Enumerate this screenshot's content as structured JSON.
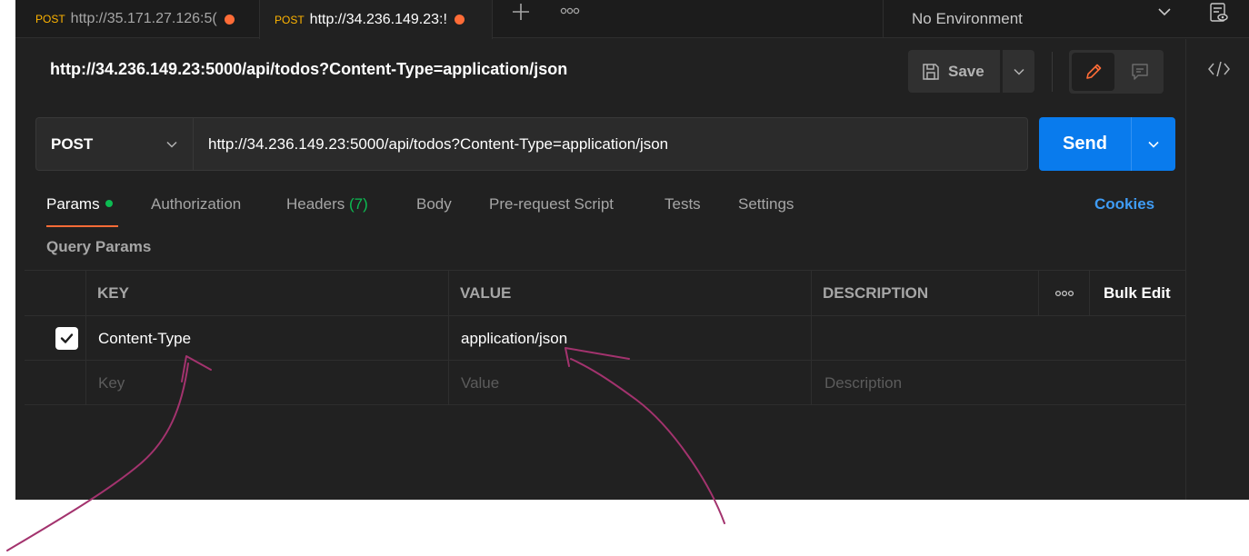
{
  "tabs": [
    {
      "method": "POST",
      "url": "http://35.171.27.126:5("
    },
    {
      "method": "POST",
      "url": "http://34.236.149.23:!"
    }
  ],
  "environment": {
    "selected": "No Environment"
  },
  "request": {
    "title": "http://34.236.149.23:5000/api/todos?Content-Type=application/json",
    "method": "POST",
    "url": "http://34.236.149.23:5000/api/todos?Content-Type=application/json"
  },
  "toolbar": {
    "save_label": "Save",
    "send_label": "Send"
  },
  "request_tabs": {
    "params": "Params",
    "authorization": "Authorization",
    "headers": "Headers",
    "headers_count": "(7)",
    "body": "Body",
    "prerequest": "Pre-request Script",
    "tests": "Tests",
    "settings": "Settings",
    "cookies": "Cookies"
  },
  "query_params": {
    "section_label": "Query Params",
    "columns": {
      "key": "KEY",
      "value": "VALUE",
      "description": "DESCRIPTION",
      "bulk_edit": "Bulk Edit"
    },
    "rows": [
      {
        "checked": true,
        "key": "Content-Type",
        "value": "application/json",
        "description": ""
      }
    ],
    "placeholders": {
      "key": "Key",
      "value": "Value",
      "description": "Description"
    }
  },
  "colors": {
    "accent_orange": "#ff6c37",
    "send_blue": "#097bed",
    "active_green": "#0cbb52",
    "annotation_ink": "#a3336e"
  }
}
